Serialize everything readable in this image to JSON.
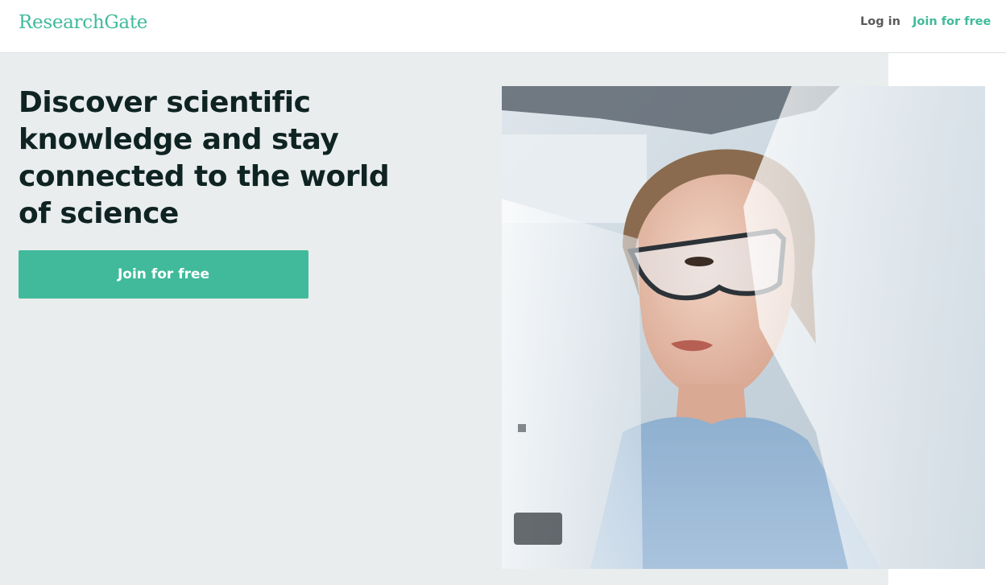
{
  "header": {
    "logo_text": "ResearchGate",
    "login_label": "Log in",
    "join_label": "Join for free"
  },
  "hero": {
    "title": "Discover scientific knowledge and stay connected to the world of science",
    "cta_label": "Join for free",
    "image_subject": "scientist-in-safety-goggles-photo"
  },
  "colors": {
    "brand": "#40ba9b",
    "hero_background": "#eaeded",
    "title_text": "#0f2323"
  }
}
